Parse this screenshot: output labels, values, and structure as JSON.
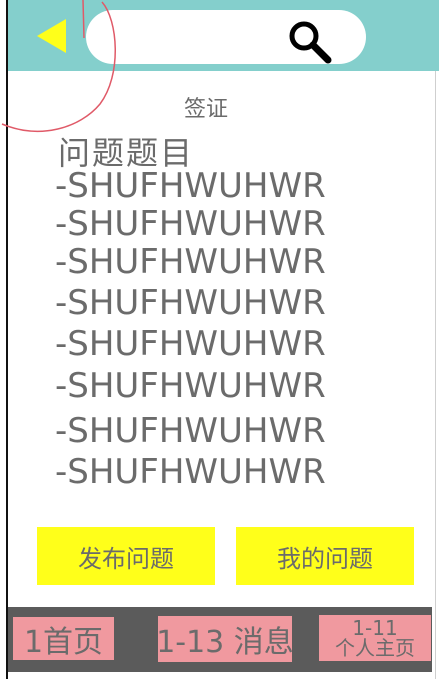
{
  "header": {
    "back_icon": "triangle-left-icon",
    "search": {
      "value": "",
      "placeholder": ""
    },
    "search_icon": "magnifier-icon",
    "accent_color": "#84cfcc"
  },
  "main": {
    "subtitle": "签证",
    "question_title": "问题题目",
    "questions": [
      "-SHUFHWUHWR",
      "-SHUFHWUHWR",
      "-SHUFHWUHWR",
      "-SHUFHWUHWR",
      "-SHUFHWUHWR",
      "-SHUFHWUHWR",
      "-SHUFHWUHWR",
      "-SHUFHWUHWR"
    ]
  },
  "actions": {
    "publish_label": "发布问题",
    "my_questions_label": "我的问题",
    "button_color": "#ffff1a"
  },
  "bottom_nav": {
    "home_label": "1首页",
    "messages_label": "1-13 消息",
    "profile_count": "1-11",
    "profile_label": "个人主页",
    "tab_color": "#f0999f"
  }
}
